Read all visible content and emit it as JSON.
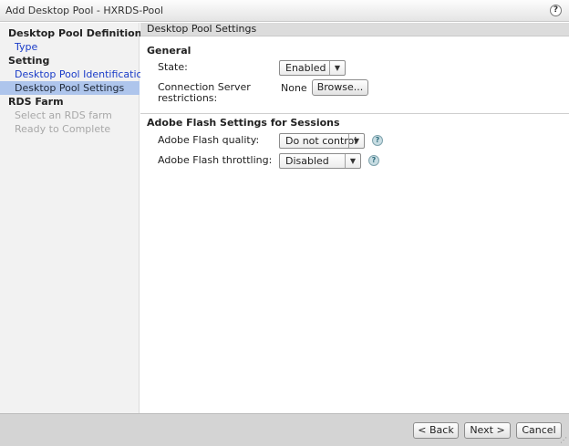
{
  "window": {
    "title": "Add Desktop Pool - HXRDS-Pool",
    "help_glyph": "?"
  },
  "sidebar": {
    "sections": [
      {
        "label": "Desktop Pool Definition",
        "steps": [
          {
            "label": "Type",
            "state": "link"
          }
        ]
      },
      {
        "label": "Setting",
        "steps": [
          {
            "label": "Desktop Pool Identification",
            "state": "link"
          },
          {
            "label": "Desktop Pool Settings",
            "state": "active"
          }
        ]
      },
      {
        "label": "RDS Farm",
        "steps": [
          {
            "label": "Select an RDS farm",
            "state": "disabled"
          },
          {
            "label": "Ready to Complete",
            "state": "disabled"
          }
        ]
      }
    ]
  },
  "content": {
    "header": "Desktop Pool Settings",
    "general": {
      "title": "General",
      "state_label": "State:",
      "state_value": "Enabled",
      "conn_label_line1": "Connection Server",
      "conn_label_line2": "restrictions:",
      "conn_value": "None",
      "browse_label": "Browse..."
    },
    "flash": {
      "title": "Adobe Flash Settings for Sessions",
      "quality_label": "Adobe Flash quality:",
      "quality_value": "Do not control",
      "throttling_label": "Adobe Flash throttling:",
      "throttling_value": "Disabled"
    }
  },
  "footer": {
    "back_label": "< Back",
    "next_label": "Next >",
    "cancel_label": "Cancel"
  },
  "icons": {
    "dropdown": "dropdown-arrow-icon",
    "info": "info-question-icon",
    "help": "help-icon",
    "resize": "resize-grip-icon"
  },
  "colors": {
    "link": "#1a3cc8",
    "active_step_bg": "#aec5ec",
    "disabled_step": "#a8a8a8",
    "sidebar_bg": "#f2f2f2",
    "footer_bg": "#d4d4d4"
  }
}
